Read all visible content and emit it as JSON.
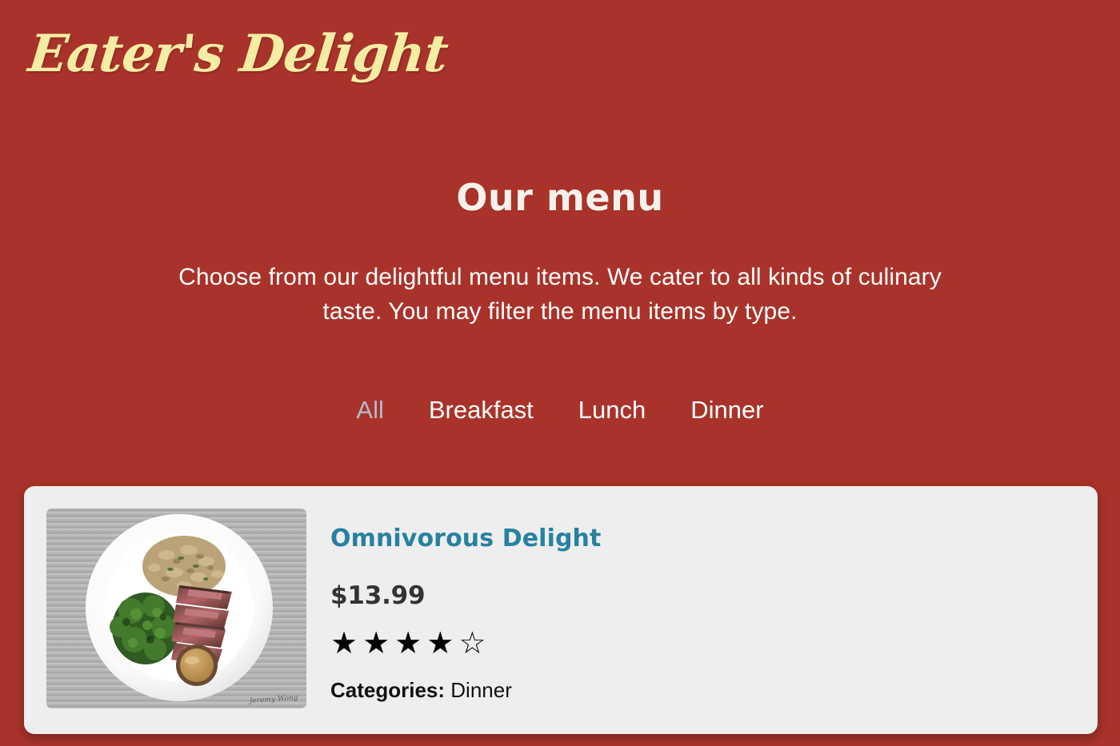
{
  "brand": {
    "logo_text": "Eater's Delight",
    "logo_color": "#f6eda4",
    "background_color": "#a9332a"
  },
  "hero": {
    "title": "Our menu",
    "subtitle": "Choose from our delightful menu items. We cater to all kinds of culinary taste. You may filter the menu items by type."
  },
  "filters": {
    "tabs": [
      {
        "label": "All",
        "active": true
      },
      {
        "label": "Breakfast",
        "active": false
      },
      {
        "label": "Lunch",
        "active": false
      },
      {
        "label": "Dinner",
        "active": false
      }
    ],
    "active_color": "#b6bace",
    "inactive_color": "#ffffff"
  },
  "menu": {
    "card_background": "#eeeeee",
    "items": [
      {
        "name": "Omnivorous Delight",
        "name_color": "#2781a0",
        "price": "$13.99",
        "rating_filled": 4,
        "rating_total": 5,
        "filled_star_glyph": "★",
        "empty_star_glyph": "☆",
        "categories_label": "Categories:",
        "categories_value": "Dinner",
        "image_alt": "Plate with sliced steak, grilled broccoli, rice pilaf and a cup of sauce on a gray wooden table",
        "image_signature": "Jeremy Wong"
      }
    ]
  }
}
